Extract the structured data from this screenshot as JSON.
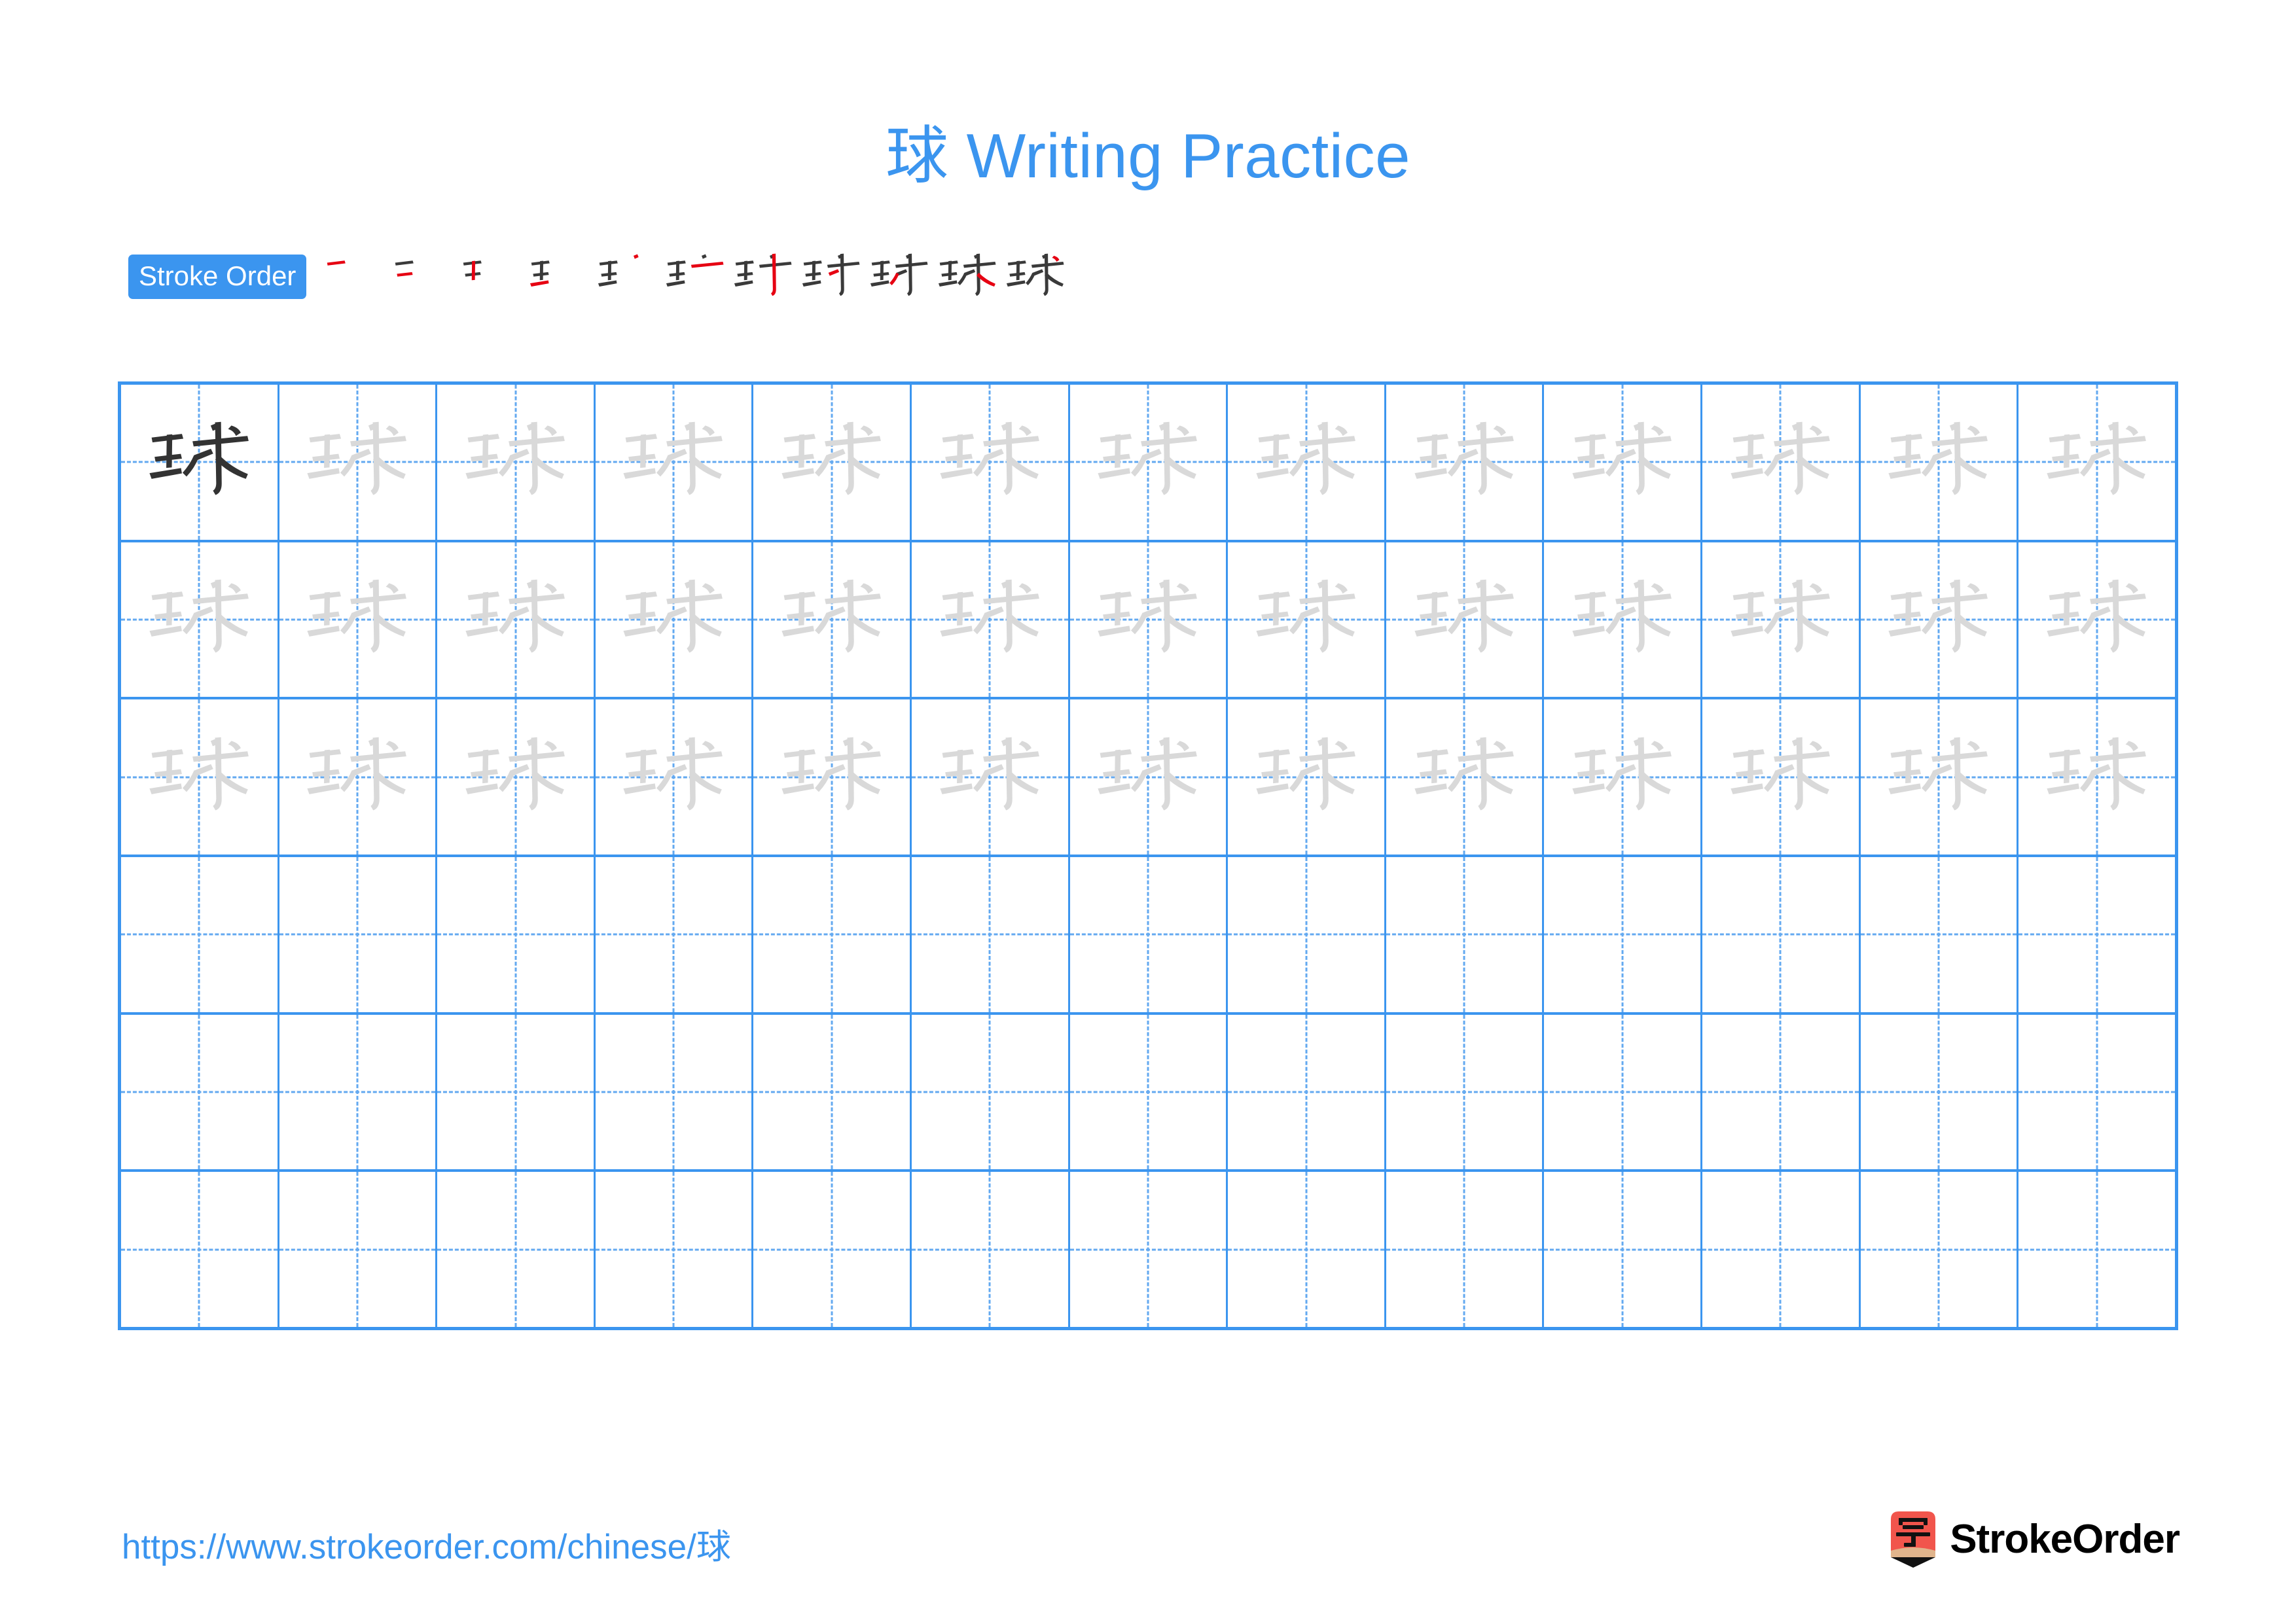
{
  "character": "球",
  "title": "球 Writing Practice",
  "stroke_order": {
    "badge_label": "Stroke Order",
    "total_strokes": 11,
    "highlight_color": "#e60012",
    "ink_color": "#3a3a3a",
    "steps": [
      {
        "index": 1,
        "strokes_shown": 1,
        "new_stroke": 1
      },
      {
        "index": 2,
        "strokes_shown": 2,
        "new_stroke": 2
      },
      {
        "index": 3,
        "strokes_shown": 3,
        "new_stroke": 3
      },
      {
        "index": 4,
        "strokes_shown": 4,
        "new_stroke": 4
      },
      {
        "index": 5,
        "strokes_shown": 5,
        "new_stroke": 5
      },
      {
        "index": 6,
        "strokes_shown": 6,
        "new_stroke": 6
      },
      {
        "index": 7,
        "strokes_shown": 7,
        "new_stroke": 7
      },
      {
        "index": 8,
        "strokes_shown": 8,
        "new_stroke": 8
      },
      {
        "index": 9,
        "strokes_shown": 9,
        "new_stroke": 9
      },
      {
        "index": 10,
        "strokes_shown": 10,
        "new_stroke": 10
      },
      {
        "index": 11,
        "strokes_shown": 11,
        "new_stroke": 11
      }
    ]
  },
  "grid": {
    "columns": 13,
    "rows": 6,
    "row_fill": [
      {
        "row": 1,
        "model_cells": 1,
        "traced_cells": 12,
        "blank_cells": 0
      },
      {
        "row": 2,
        "model_cells": 0,
        "traced_cells": 13,
        "blank_cells": 0
      },
      {
        "row": 3,
        "model_cells": 0,
        "traced_cells": 13,
        "blank_cells": 0
      },
      {
        "row": 4,
        "model_cells": 0,
        "traced_cells": 0,
        "blank_cells": 13
      },
      {
        "row": 5,
        "model_cells": 0,
        "traced_cells": 0,
        "blank_cells": 13
      },
      {
        "row": 6,
        "model_cells": 0,
        "traced_cells": 0,
        "blank_cells": 13
      }
    ]
  },
  "footer": {
    "url": "https://www.strokeorder.com/chinese/球",
    "brand_name": "StrokeOrder",
    "brand_mark_char": "字"
  },
  "colors": {
    "accent_blue": "#3b95ef",
    "guide_blue": "#63a9f0",
    "ink_dark": "#333333",
    "trace_gray": "#d9d9d9",
    "stroke_red": "#e60012",
    "logo_red": "#f1554c",
    "logo_tan": "#e0b48c"
  }
}
